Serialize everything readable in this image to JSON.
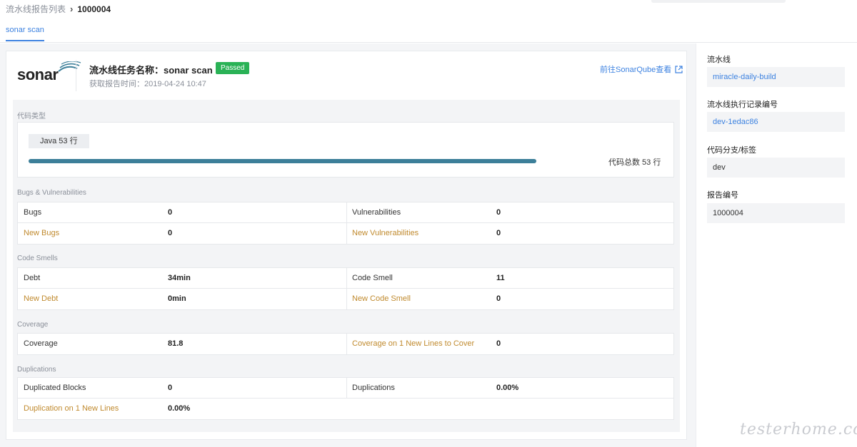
{
  "breadcrumb": {
    "parent": "流水线报告列表",
    "current": "1000004"
  },
  "tabs": [
    {
      "label": "sonar scan"
    }
  ],
  "header": {
    "logo_text": "sonar",
    "title": "流水线任务名称：sonar scan",
    "status": "Passed",
    "fetch_time": "获取报告时间：2019-04-24 10:47",
    "sonarqube_link": "前往SonarQube查看"
  },
  "code_type": {
    "label": "代码类型",
    "language_tag": "Java 53 行",
    "progress": 1.0,
    "total": "代码总数 53 行"
  },
  "bugs": {
    "label": "Bugs & Vulnerabilities",
    "rows": [
      {
        "k1": "Bugs",
        "v1": "0",
        "k2": "Vulnerabilities",
        "v2": "0"
      },
      {
        "k1": "New Bugs",
        "v1": "0",
        "k2": "New Vulnerabilities",
        "v2": "0"
      }
    ]
  },
  "smells": {
    "label": "Code Smells",
    "rows": [
      {
        "k1": "Debt",
        "v1": "34min",
        "k2": "Code Smell",
        "v2": "11"
      },
      {
        "k1": "New Debt",
        "v1": "0min",
        "k2": "New Code Smell",
        "v2": "0"
      }
    ]
  },
  "coverage": {
    "label": "Coverage",
    "rows": [
      {
        "k1": "Coverage",
        "v1": "81.8",
        "k2": "Coverage on 1 New Lines to Cover",
        "v2": "0"
      }
    ]
  },
  "duplications": {
    "label": "Duplications",
    "rows": [
      {
        "k1": "Duplicated Blocks",
        "v1": "0",
        "k2": "Duplications",
        "v2": "0.00%"
      },
      {
        "k1": "Duplication on 1 New Lines",
        "v1": "0.00%",
        "k2": "",
        "v2": ""
      }
    ]
  },
  "sidebar": {
    "pipeline_label": "流水线",
    "pipeline_value": "miracle-daily-build",
    "exec_label": "流水线执行记录编号",
    "exec_value": "dev-1edac86",
    "branch_label": "代码分支/标签",
    "branch_value": "dev",
    "report_label": "报告编号",
    "report_value": "1000004"
  },
  "watermark": "testerhome.com",
  "colors": {
    "accent": "#3d82e0",
    "passed": "#2ab256",
    "new_metric": "#c08a2e",
    "bar": "#3c7f99"
  }
}
